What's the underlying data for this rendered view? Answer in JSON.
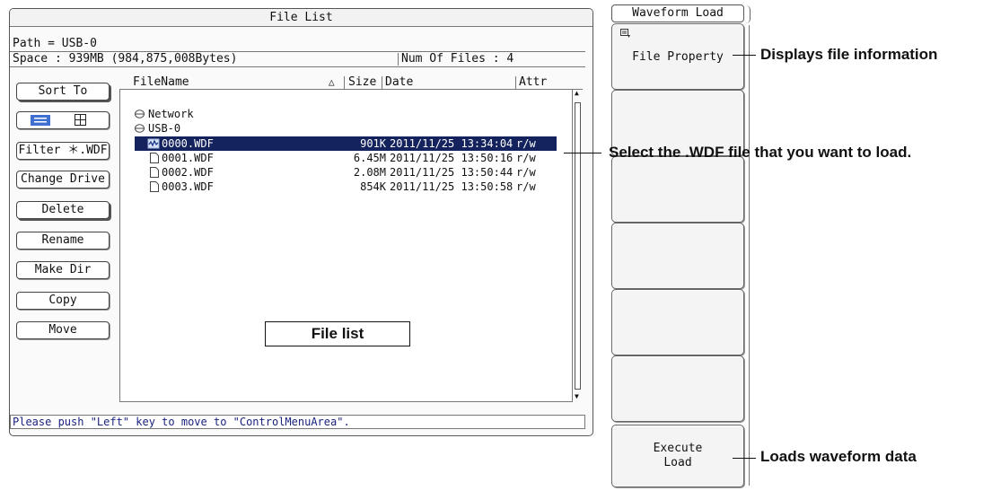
{
  "file_list_window": {
    "title": "File List",
    "path": "Path = USB-0",
    "space": "Space : 939MB (984,875,008Bytes)",
    "num_files": "Num Of Files : 4",
    "columns": {
      "filename": "FileName",
      "sort_indicator": "△",
      "size": "Size",
      "date": "Date",
      "attr": "Attr"
    },
    "buttons": {
      "sort_to": "Sort To",
      "filter": "Filter ＊.WDF",
      "change_drive": "Change Drive",
      "delete": "Delete",
      "rename": "Rename",
      "make_dir": "Make Dir",
      "copy": "Copy",
      "move": "Move"
    },
    "drives": [
      "Network",
      "USB-0"
    ],
    "files": [
      {
        "name": "0000.WDF",
        "size": "901K",
        "date": "2011/11/25 13:34:04",
        "attr": "r/w",
        "selected": true
      },
      {
        "name": "0001.WDF",
        "size": "6.45M",
        "date": "2011/11/25 13:50:16",
        "attr": "r/w",
        "selected": false
      },
      {
        "name": "0002.WDF",
        "size": "2.08M",
        "date": "2011/11/25 13:50:44",
        "attr": "r/w",
        "selected": false
      },
      {
        "name": "0003.WDF",
        "size": "854K",
        "date": "2011/11/25 13:50:58",
        "attr": "r/w",
        "selected": false
      }
    ],
    "status_message": "Please push \"Left\" key to move to \"ControlMenuArea\"."
  },
  "soft_menu": {
    "title": "Waveform Load",
    "file_property": "File Property",
    "execute_line1": "Execute",
    "execute_line2": "Load"
  },
  "callouts": {
    "file_property": "Displays file information",
    "select_file": "Select the .WDF file that you want to load.",
    "execute": "Loads waveform data",
    "file_list": "File list"
  },
  "colors": {
    "selection": "#14235e",
    "status_text": "#1a237e",
    "view_icon": "#3f6fd0"
  }
}
